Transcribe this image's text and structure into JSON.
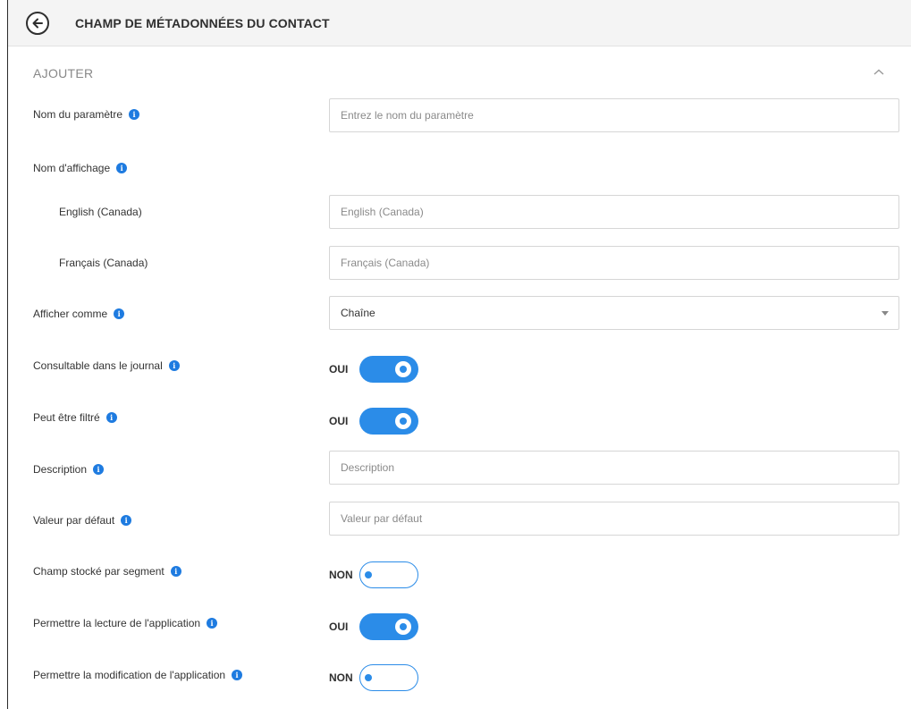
{
  "header": {
    "title": "CHAMP DE MÉTADONNÉES DU CONTACT",
    "back_icon": "arrow-left-circle-icon"
  },
  "section": {
    "title": "AJOUTER",
    "collapse_icon": "chevron-up-icon"
  },
  "colors": {
    "accent": "#2b8ce8",
    "info": "#1e7be0",
    "header_bg": "#f4f4f4"
  },
  "form": {
    "param_name": {
      "label": "Nom du paramètre",
      "placeholder": "Entrez le nom du paramètre",
      "value": ""
    },
    "display_name": {
      "label": "Nom d'affichage"
    },
    "en_ca": {
      "label": "English (Canada)",
      "placeholder": "English (Canada)",
      "value": ""
    },
    "fr_ca": {
      "label": "Français (Canada)",
      "placeholder": "Français (Canada)",
      "value": ""
    },
    "display_as": {
      "label": "Afficher comme",
      "value": "Chaîne"
    },
    "searchable": {
      "label": "Consultable dans le journal",
      "state_label": "OUI",
      "on": true
    },
    "filterable": {
      "label": "Peut être filtré",
      "state_label": "OUI",
      "on": true
    },
    "description": {
      "label": "Description",
      "placeholder": "Description",
      "value": ""
    },
    "default_value": {
      "label": "Valeur par défaut",
      "placeholder": "Valeur par défaut",
      "value": ""
    },
    "per_segment": {
      "label": "Champ stocké par segment",
      "state_label": "NON",
      "on": false
    },
    "app_read": {
      "label": "Permettre la lecture de l'application",
      "state_label": "OUI",
      "on": true
    },
    "app_edit": {
      "label": "Permettre la modification de l'application",
      "state_label": "NON",
      "on": false
    }
  }
}
